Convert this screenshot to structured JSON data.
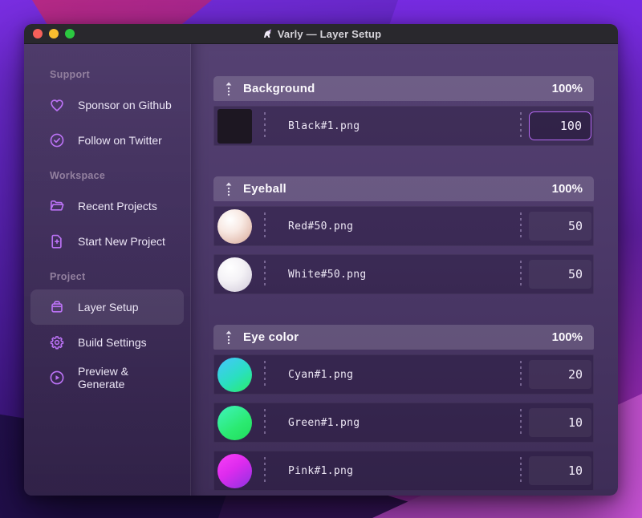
{
  "window": {
    "title": "Varly — Layer Setup",
    "title_icon": "unicorn"
  },
  "sidebar": {
    "sections": [
      {
        "label": "Support",
        "items": [
          {
            "icon": "heart-icon",
            "label": "Sponsor on Github"
          },
          {
            "icon": "badge-check-icon",
            "label": "Follow on Twitter"
          }
        ]
      },
      {
        "label": "Workspace",
        "items": [
          {
            "icon": "folder-icon",
            "label": "Recent Projects"
          },
          {
            "icon": "file-plus-icon",
            "label": "Start New Project"
          }
        ]
      },
      {
        "label": "Project",
        "items": [
          {
            "icon": "archive-icon",
            "label": "Layer Setup",
            "selected": true
          },
          {
            "icon": "gear-icon",
            "label": "Build Settings"
          },
          {
            "icon": "play-circle-icon",
            "label": "Preview & Generate"
          }
        ]
      }
    ]
  },
  "layers": {
    "groups": [
      {
        "name": "Background",
        "weight": "100%",
        "rows": [
          {
            "file": "Black#1.png",
            "value": "100",
            "thumb": "black-square",
            "focused": true
          }
        ]
      },
      {
        "name": "Eyeball",
        "weight": "100%",
        "rows": [
          {
            "file": "Red#50.png",
            "value": "50",
            "thumb": "red-sphere"
          },
          {
            "file": "White#50.png",
            "value": "50",
            "thumb": "white-sphere"
          }
        ]
      },
      {
        "name": "Eye color",
        "weight": "100%",
        "rows": [
          {
            "file": "Cyan#1.png",
            "value": "20",
            "thumb": "cyan-circle"
          },
          {
            "file": "Green#1.png",
            "value": "10",
            "thumb": "green-circle"
          },
          {
            "file": "Pink#1.png",
            "value": "10",
            "thumb": "magenta-circle"
          }
        ]
      }
    ]
  },
  "colors": {
    "accent": "#bb72f5",
    "focus_ring": "#b468f2",
    "traffic_close": "#f5605a",
    "traffic_minimize": "#f8bd2f",
    "traffic_zoom": "#2bc840"
  }
}
